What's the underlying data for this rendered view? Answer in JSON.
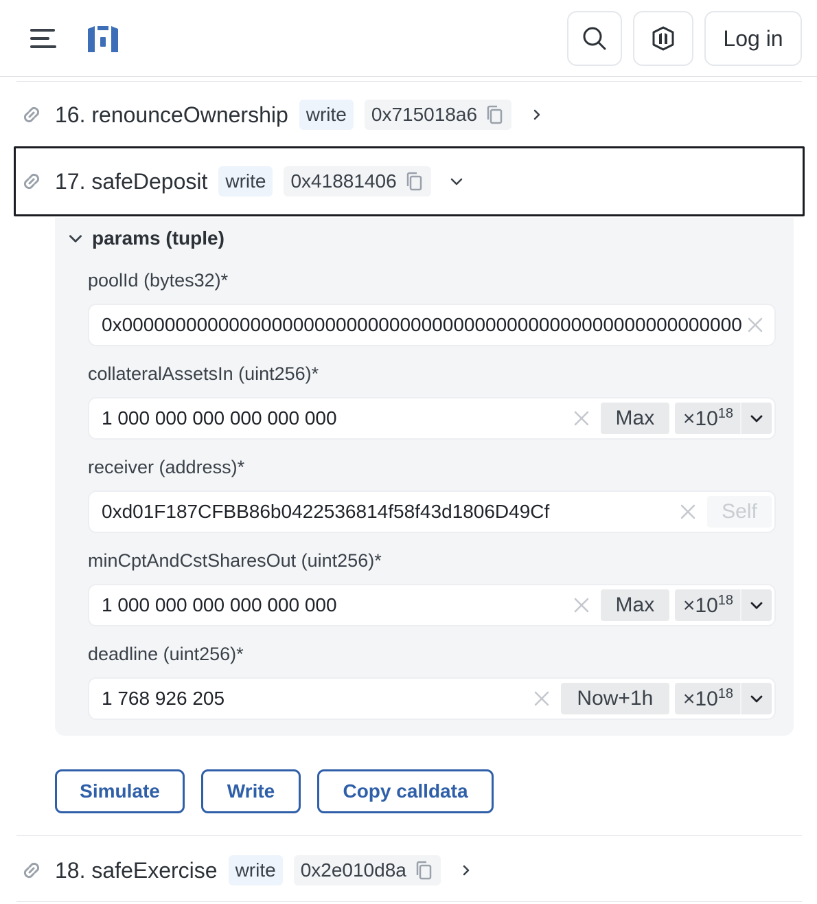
{
  "header": {
    "login_label": "Log in",
    "icons": [
      "menu-icon",
      "logo",
      "search-icon",
      "shield-icon"
    ]
  },
  "methods": [
    {
      "label": "16. renounceOwnership",
      "badge": "write",
      "selector": "0x715018a6",
      "expanded": false
    },
    {
      "label": "17. safeDeposit",
      "badge": "write",
      "selector": "0x41881406",
      "expanded": true
    },
    {
      "label": "18. safeExercise",
      "badge": "write",
      "selector": "0x2e010d8a",
      "expanded": false
    }
  ],
  "params": {
    "title": "params (tuple)",
    "fields": [
      {
        "label": "poolId (bytes32)*",
        "value": "0x0000000000000000000000000000000000000000000000000000000000000000"
      },
      {
        "label": "collateralAssetsIn (uint256)*",
        "value": "1 000 000 000 000 000 000",
        "action": "Max",
        "multiplier_base": "×10",
        "multiplier_exp": "18"
      },
      {
        "label": "receiver (address)*",
        "value": "0xd01F187CFBB86b0422536814f58f43d1806D49Cf",
        "action": "Self"
      },
      {
        "label": "minCptAndCstSharesOut (uint256)*",
        "value": "1 000 000 000 000 000 000",
        "action": "Max",
        "multiplier_base": "×10",
        "multiplier_exp": "18"
      },
      {
        "label": "deadline (uint256)*",
        "value": "1 768 926 205",
        "action": "Now+1h",
        "multiplier_base": "×10",
        "multiplier_exp": "18"
      }
    ]
  },
  "actions": {
    "simulate": "Simulate",
    "write": "Write",
    "copy_calldata": "Copy calldata"
  },
  "colors": {
    "accent": "#2f5fa8",
    "badge_bg": "#eef4fb",
    "card_bg": "#f4f5f7"
  }
}
